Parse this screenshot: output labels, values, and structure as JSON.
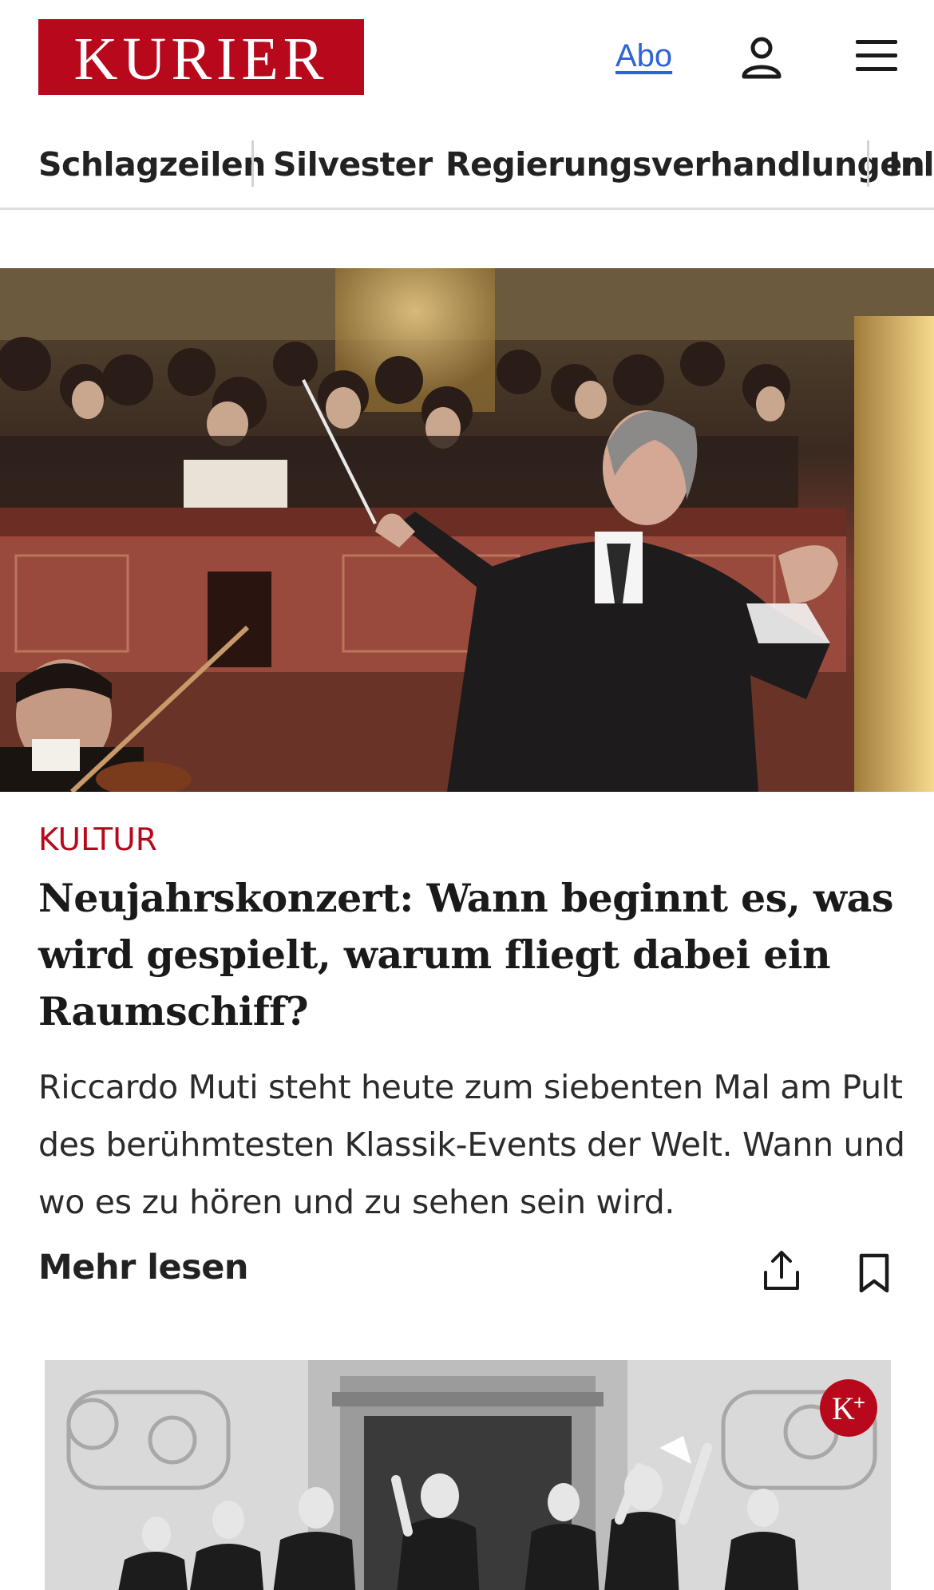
{
  "header": {
    "logo_text": "KURIER",
    "abo_label": "Abo"
  },
  "nav": {
    "items": [
      "Schlagzeilen",
      "Silvester",
      "Regierungsverhandlungen",
      "Inla"
    ]
  },
  "article": {
    "kicker": "KULTUR",
    "headline": "Neujahrskonzert: Wann beginnt es, was wird gespielt, warum fliegt dabei ein Raumschiff?",
    "teaser": "Riccardo Muti steht heute zum siebenten Mal am Pult des berühmtesten Klassik-Events der Welt. Wann und wo es zu hören und zu sehen sein wird.",
    "more_label": "Mehr lesen"
  },
  "next_card": {
    "badge_text": "K",
    "badge_sup": "+"
  },
  "colors": {
    "brand": "#b8081c",
    "link": "#2f63d8"
  },
  "icons": [
    "user-icon",
    "menu-icon",
    "share-icon",
    "bookmark-icon"
  ]
}
